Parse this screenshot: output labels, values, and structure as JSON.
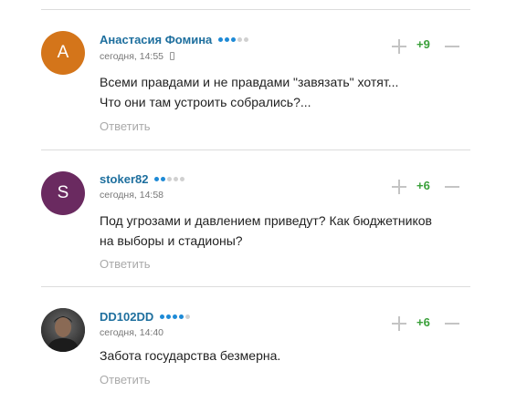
{
  "colors": {
    "author": "#1e6f9e",
    "score": "#3aa03a",
    "reply": "#aaaaaa",
    "dot_active": "#1e8ad6",
    "dot_inactive": "#d0d0d0"
  },
  "comments": [
    {
      "avatar_letter": "А",
      "avatar_color": "#d4751a",
      "author": "Анастасия Фомина",
      "rating_dots": 3,
      "time": "сегодня, 14:55",
      "device_icon": "mobile-phone-icon",
      "text_lines": [
        "Всеми правдами и не правдами \"завязать\" хотят...",
        "Что они там устроить собрались?..."
      ],
      "reply_label": "Ответить",
      "score": "+9"
    },
    {
      "avatar_letter": "S",
      "avatar_color": "#6a2a60",
      "author": "stoker82",
      "rating_dots": 2,
      "time": "сегодня, 14:58",
      "text_lines": [
        "Под угрозами и давлением приведут? Как бюджетников",
        "на выборы и стадионы?"
      ],
      "reply_label": "Ответить",
      "score": "+6"
    },
    {
      "avatar_photo": "user-photo-avatar",
      "author": "DD102DD",
      "rating_dots": 4,
      "time": "сегодня, 14:40",
      "text_lines": [
        "Забота государства безмерна."
      ],
      "reply_label": "Ответить",
      "score": "+6"
    }
  ]
}
